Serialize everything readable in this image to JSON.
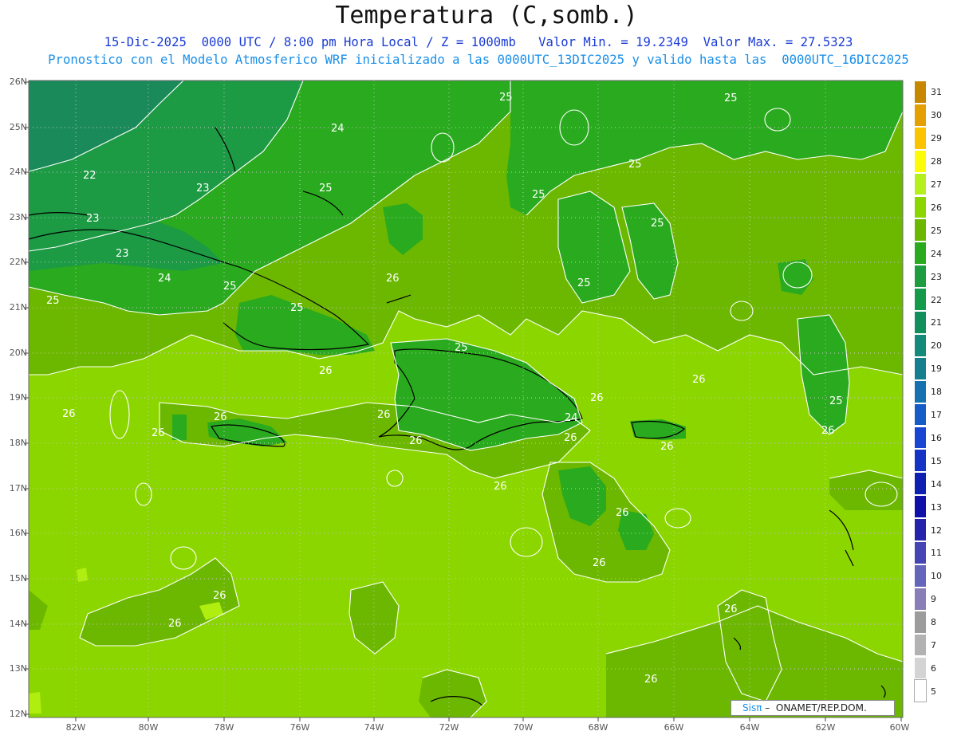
{
  "header": {
    "title": "Temperatura (C,somb.)",
    "subtitle_1": "15-Dic-2025  0000 UTC / 8:00 pm Hora Local / Z = 1000mb   Valor Min. = 19.2349  Valor Max. = 27.5323",
    "subtitle_2": "Pronostico con el Modelo Atmosferico WRF inicializado a las 0000UTC_13DIC2025 y valido hasta las  0000UTC_16DIC2025"
  },
  "map": {
    "variable": "Temperatura",
    "units": "C",
    "level": "1000mb",
    "valid_time": "15-Dic-2025 0000 UTC",
    "value_min": 19.2349,
    "value_max": 27.5323,
    "lat_ticks": [
      "26N",
      "25N",
      "24N",
      "23N",
      "22N",
      "21N",
      "20N",
      "19N",
      "18N",
      "17N",
      "16N",
      "15N",
      "14N",
      "13N",
      "12N"
    ],
    "lon_ticks": [
      "82W",
      "80W",
      "78W",
      "76W",
      "74W",
      "72W",
      "70W",
      "68W",
      "66W",
      "64W",
      "62W",
      "60W"
    ],
    "contour_labels": [
      "25",
      "25",
      "24",
      "25",
      "22",
      "23",
      "23",
      "25",
      "23",
      "24",
      "25",
      "25",
      "25",
      "26",
      "25",
      "25",
      "25",
      "26",
      "26",
      "26",
      "26",
      "25",
      "26",
      "26",
      "24",
      "26",
      "26",
      "26",
      "26",
      "26",
      "26",
      "26",
      "26",
      "26",
      "25",
      "26",
      "26",
      "26"
    ],
    "dominant_fill_colors": {
      "26": "#8cd600",
      "25": "#6cb800",
      "24": "#2aaa1e",
      "23": "#1c9a44",
      "22": "#1a8a5a",
      "27": "#b0ee10"
    }
  },
  "colorbar": {
    "labels": [
      "31",
      "30",
      "29",
      "28",
      "27",
      "26",
      "25",
      "24",
      "23",
      "22",
      "21",
      "20",
      "19",
      "18",
      "17",
      "16",
      "15",
      "14",
      "13",
      "12",
      "11",
      "10",
      "9",
      "8",
      "7",
      "6",
      "5"
    ],
    "colors": [
      "#c88700",
      "#e49f00",
      "#fbc300",
      "#fcfc08",
      "#b4f01c",
      "#8cd600",
      "#6cb800",
      "#2aaa1e",
      "#1e9c40",
      "#159a4c",
      "#12905c",
      "#138a7a",
      "#157f8e",
      "#1672ae",
      "#165cc8",
      "#1746d2",
      "#1533c4",
      "#0f1fb0",
      "#0e10a8",
      "#2522ac",
      "#4546b4",
      "#6466bc",
      "#8a7eb6",
      "#9c9c9c",
      "#b2b2b2",
      "#d4d4d4",
      "#ffffff"
    ]
  },
  "credit": {
    "brand": "Sisπ",
    "text": " –  ONAMET/REP.DOM."
  }
}
